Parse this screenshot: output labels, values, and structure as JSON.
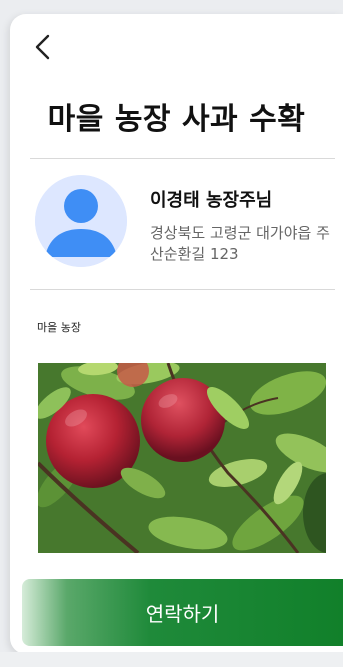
{
  "header": {
    "back_icon": "chevron-left-icon",
    "title": "마을 농장 사과 수확"
  },
  "profile": {
    "avatar_icon": "user-avatar-icon",
    "name": "이경태 농장주님",
    "address": "경상북도 고령군 대가야읍 주산순환길 123"
  },
  "section": {
    "label": "마을 농장"
  },
  "photo": {
    "subject": "apple-tree-photo"
  },
  "actions": {
    "contact_label": "연락하기"
  },
  "colors": {
    "accent_green": "#11802a",
    "avatar_bg": "#dde7ff",
    "avatar_fg": "#3f8ef5"
  }
}
